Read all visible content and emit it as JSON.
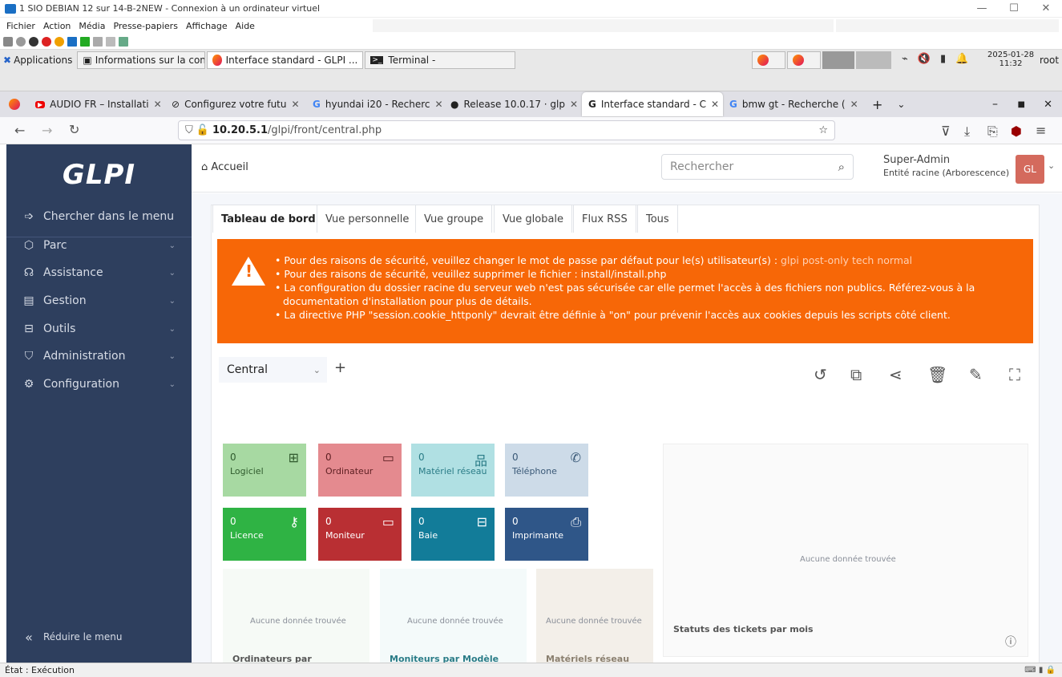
{
  "vm": {
    "title": "1 SIO DEBIAN 12 sur 14-B-2NEW - Connexion à un ordinateur virtuel",
    "menu": [
      "Fichier",
      "Action",
      "Média",
      "Presse-papiers",
      "Affichage",
      "Aide"
    ],
    "status": "État : Exécution"
  },
  "xfce": {
    "applications": "Applications",
    "tasks": [
      "Informations sur la connexi...",
      "Interface standard - GLPI ...",
      "Terminal -"
    ],
    "clock_date": "2025-01-28",
    "clock_time": "11:32",
    "user": "root"
  },
  "firefox": {
    "tabs": [
      {
        "label": "AUDIO FR – Installati"
      },
      {
        "label": "Configurez votre futu"
      },
      {
        "label": "hyundai i20 - Recherc"
      },
      {
        "label": "Release 10.0.17 · glp"
      },
      {
        "label": "Interface standard - C"
      },
      {
        "label": "bmw gt - Recherche ("
      }
    ],
    "url_host": "10.20.5.1",
    "url_path": "/glpi/front/central.php"
  },
  "glpi": {
    "brand": "GLPI",
    "sidebar": [
      {
        "label": "Chercher dans le menu",
        "icon": "arrow-right-icon"
      },
      {
        "label": "Parc",
        "icon": "cube-icon"
      },
      {
        "label": "Assistance",
        "icon": "headset-icon"
      },
      {
        "label": "Gestion",
        "icon": "wallet-icon"
      },
      {
        "label": "Outils",
        "icon": "briefcase-icon"
      },
      {
        "label": "Administration",
        "icon": "shield-icon"
      },
      {
        "label": "Configuration",
        "icon": "gear-icon"
      }
    ],
    "collapse": "Réduire le menu",
    "breadcrumb": "Accueil",
    "search_placeholder": "Rechercher",
    "user_name": "Super-Admin",
    "user_entity": "Entité racine (Arborescence)",
    "avatar": "GL",
    "tabs": [
      "Tableau de bord",
      "Vue personnelle",
      "Vue groupe",
      "Vue globale",
      "Flux RSS",
      "Tous"
    ],
    "alerts": [
      {
        "text": "Pour des raisons de sécurité, veuillez changer le mot de passe par défaut pour le(s) utilisateur(s) : ",
        "users": "glpi post-only tech normal"
      },
      {
        "text": "Pour des raisons de sécurité, veuillez supprimer le fichier : install/install.php"
      },
      {
        "text": "La configuration du dossier racine du serveur web n'est pas sécurisée car elle permet l'accès à des fichiers non publics. Référez-vous à la documentation d'installation pour plus de détails."
      },
      {
        "text": "La directive PHP \"session.cookie_httponly\" devrait être définie à \"on\" pour prévenir l'accès aux cookies depuis les scripts côté client."
      }
    ],
    "dashboard_select": "Central",
    "tiles": [
      {
        "count": "0",
        "label": "Logiciel",
        "color": "#a7d9a2",
        "icon": "apps-icon"
      },
      {
        "count": "0",
        "label": "Ordinateur",
        "color": "#e48a8f",
        "icon": "laptop-icon"
      },
      {
        "count": "0",
        "label": "Matériel réseau",
        "color": "#b0e0e3",
        "icon": "network-icon"
      },
      {
        "count": "0",
        "label": "Téléphone",
        "color": "#cddbe8",
        "icon": "phone-icon"
      },
      {
        "count": "0",
        "label": "Licence",
        "color": "#2fb344",
        "icon": "key-icon"
      },
      {
        "count": "0",
        "label": "Moniteur",
        "color": "#b92f33",
        "icon": "monitor-icon"
      },
      {
        "count": "0",
        "label": "Baie",
        "color": "#127c99",
        "icon": "server-icon"
      },
      {
        "count": "0",
        "label": "Imprimante",
        "color": "#2f5688",
        "icon": "printer-icon"
      }
    ],
    "no_data": "Aucune donnée trouvée",
    "widgets": [
      "Ordinateurs par",
      "Moniteurs par Modèle",
      "Matériels réseau"
    ],
    "ticket_widget_title": "Statuts des tickets par mois"
  }
}
